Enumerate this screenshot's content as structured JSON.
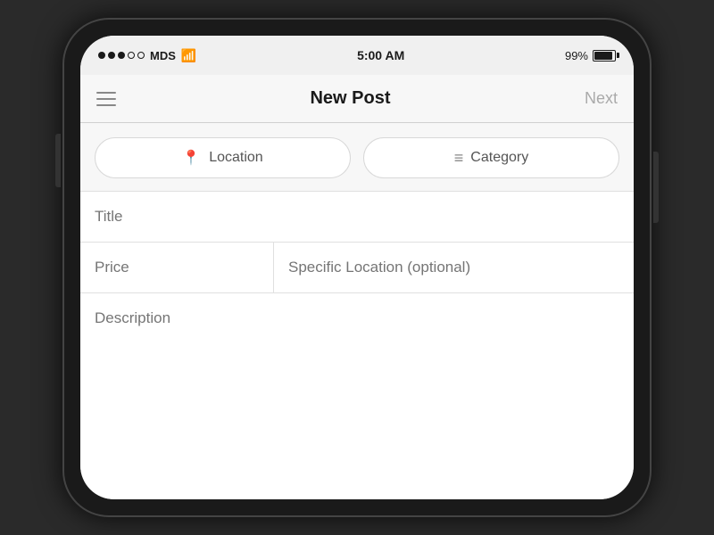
{
  "statusBar": {
    "carrier": "MDS",
    "time": "5:00 AM",
    "battery": "99%"
  },
  "navBar": {
    "title": "New Post",
    "nextLabel": "Next",
    "menuLabel": "Menu"
  },
  "pillButtons": {
    "location": {
      "label": "Location",
      "icon": "📍"
    },
    "category": {
      "label": "Category",
      "icon": "≡"
    }
  },
  "form": {
    "titlePlaceholder": "Title",
    "pricePlaceholder": "Price",
    "specificLocationPlaceholder": "Specific Location (optional)",
    "descriptionPlaceholder": "Description"
  }
}
